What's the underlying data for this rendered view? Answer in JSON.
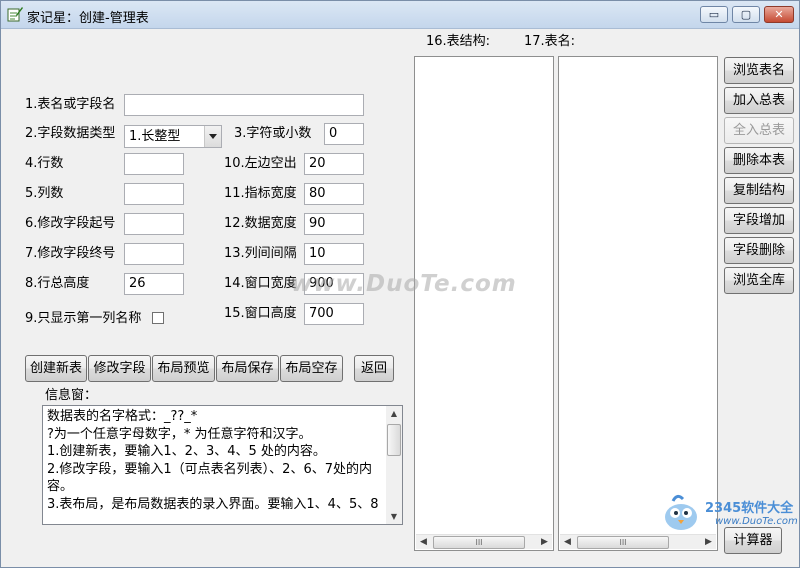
{
  "window": {
    "title": "家记星：创建-管理表",
    "min_glyph": "▭",
    "max_glyph": "▢",
    "close_glyph": "✕"
  },
  "headers": {
    "table_structure": "16.表结构:",
    "table_name": "17.表名:"
  },
  "form": {
    "field1_label": "1.表名或字段名",
    "field1_value": "",
    "field2_label": "2.字段数据类型",
    "field2_value": "1.长整型",
    "field3_label": "3.字符或小数",
    "field3_value": "0",
    "field4_label": "4.行数",
    "field4_value": "",
    "field5_label": "5.列数",
    "field5_value": "",
    "field6_label": "6.修改字段起号",
    "field6_value": "",
    "field7_label": "7.修改字段终号",
    "field7_value": "",
    "field8_label": "8.行总高度",
    "field8_value": "26",
    "field9_label": "9.只显示第一列名称",
    "field10_label": "10.左边空出",
    "field10_value": "20",
    "field11_label": "11.指标宽度",
    "field11_value": "80",
    "field12_label": "12.数据宽度",
    "field12_value": "90",
    "field13_label": "13.列间间隔",
    "field13_value": "10",
    "field14_label": "14.窗口宽度",
    "field14_value": "900",
    "field15_label": "15.窗口高度",
    "field15_value": "700"
  },
  "actions": {
    "create": "创建新表",
    "modify": "修改字段",
    "preview": "布局预览",
    "save": "布局保存",
    "clear": "布局空存",
    "back": "返回"
  },
  "info": {
    "label": "信息窗：",
    "lines": [
      "数据表的名字格式：_??_*",
      " ?为一个任意字母数字，* 为任意字符和汉字。",
      "1.创建新表，要输入1、2、3、4、5 处的内容。",
      "2.修改字段，要输入1（可点表名列表）、2、6、7处的内",
      "容。",
      "3.表布局，是布局数据表的录入界面。要输入1、4、5、8"
    ]
  },
  "side_buttons": {
    "browse_names": "浏览表名",
    "add_total": "加入总表",
    "all_total": "全入总表",
    "delete_table": "删除本表",
    "copy_structure": "复制结构",
    "add_field": "字段增加",
    "delete_field": "字段删除",
    "browse_all": "浏览全库",
    "calculator": "计算器"
  },
  "scroll": {
    "left_arrow": "◀",
    "right_arrow": "▶",
    "up_arrow": "▲",
    "down_arrow": "▼",
    "grip": "III"
  },
  "watermark": "www.DuoTe.com",
  "logo": {
    "name": "2345软件大全",
    "url": "www.DuoTe.com"
  }
}
